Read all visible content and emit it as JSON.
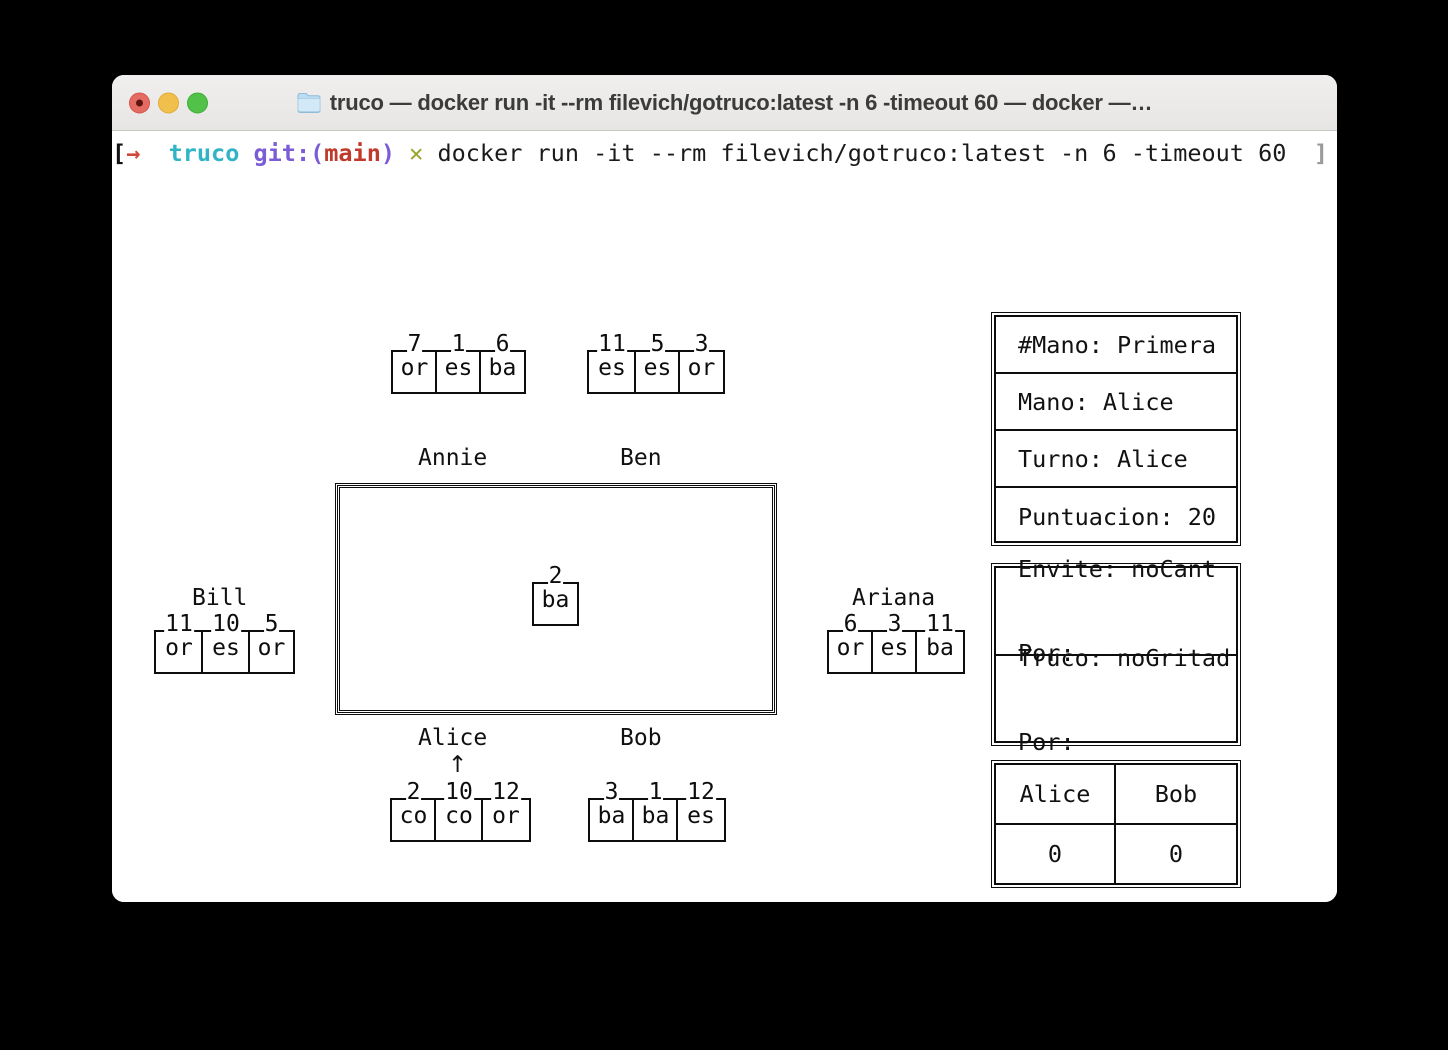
{
  "window": {
    "title": "truco — docker run -it --rm filevich/gotruco:latest -n 6 -timeout 60 — docker —…",
    "folder_icon": "folder-icon",
    "lights": [
      {
        "name": "close-button",
        "color": "#e46b61"
      },
      {
        "name": "minimize-button",
        "color": "#f1bf4b"
      },
      {
        "name": "maximize-button",
        "color": "#52c14a"
      }
    ]
  },
  "prompt": {
    "bracket_open": "[",
    "arrow": "→",
    "repo": "truco",
    "git_prefix": "git:(",
    "branch": "main",
    "git_suffix": ")",
    "status_mark": "✕",
    "command": "docker run -it --rm filevich/gotruco:latest -n 6 -timeout 60",
    "bracket_close": "]",
    "colors": {
      "repo": "#31b4c6",
      "git": "#7b5bd6",
      "branch": "#c03a2b",
      "arrow": "#d04a3a",
      "status_mark": "#9aa32a",
      "bracket_close": "#9a9a9a"
    }
  },
  "players": {
    "annie": {
      "name": "Annie",
      "is_turn": false,
      "cards": [
        {
          "rank": "7",
          "suit": "or"
        },
        {
          "rank": "1",
          "suit": "es"
        },
        {
          "rank": "6",
          "suit": "ba"
        }
      ]
    },
    "ben": {
      "name": "Ben",
      "is_turn": false,
      "cards": [
        {
          "rank": "11",
          "suit": "es"
        },
        {
          "rank": "5",
          "suit": "es"
        },
        {
          "rank": "3",
          "suit": "or"
        }
      ]
    },
    "bill": {
      "name": "Bill",
      "is_turn": false,
      "cards": [
        {
          "rank": "11",
          "suit": "or"
        },
        {
          "rank": "10",
          "suit": "es"
        },
        {
          "rank": "5",
          "suit": "or"
        }
      ]
    },
    "ariana": {
      "name": "Ariana",
      "is_turn": false,
      "cards": [
        {
          "rank": "6",
          "suit": "or"
        },
        {
          "rank": "3",
          "suit": "es"
        },
        {
          "rank": "11",
          "suit": "ba"
        }
      ]
    },
    "alice": {
      "name": "Alice",
      "is_turn": true,
      "turn_arrow": "↑",
      "cards": [
        {
          "rank": "2",
          "suit": "co"
        },
        {
          "rank": "10",
          "suit": "co"
        },
        {
          "rank": "12",
          "suit": "or"
        }
      ]
    },
    "bob": {
      "name": "Bob",
      "is_turn": false,
      "cards": [
        {
          "rank": "3",
          "suit": "ba"
        },
        {
          "rank": "1",
          "suit": "ba"
        },
        {
          "rank": "12",
          "suit": "es"
        }
      ]
    }
  },
  "table": {
    "played_cards": [
      {
        "rank": "2",
        "suit": "ba"
      }
    ]
  },
  "status_panel": {
    "rows": [
      "#Mano: Primera",
      "Mano: Alice",
      "Turno: Alice",
      "Puntuacion: 20"
    ]
  },
  "calls_panel": {
    "rows": [
      {
        "line1": "Envite: noCant",
        "line2": "Por:"
      },
      {
        "line1": "Truco: noGritad",
        "line2": "Por:"
      }
    ]
  },
  "score_panel": {
    "columns": [
      {
        "name": "Alice",
        "score": "0"
      },
      {
        "name": "Bob",
        "score": "0"
      }
    ]
  }
}
